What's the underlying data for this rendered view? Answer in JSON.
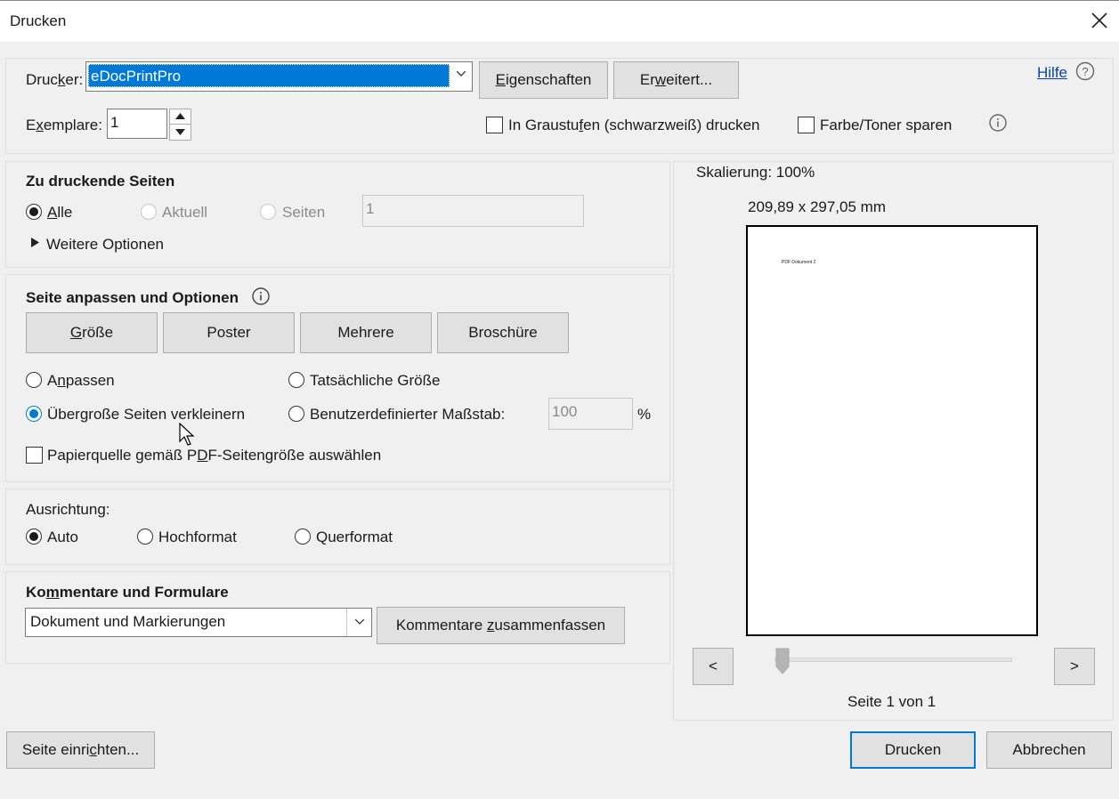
{
  "window": {
    "title": "Drucken"
  },
  "printer": {
    "label": "Drucker:",
    "value": "eDocPrintPro",
    "properties_button": "Eigenschaften",
    "advanced_button": "Erweitert...",
    "help_link": "Hilfe"
  },
  "copies": {
    "label": "Exemplare:",
    "value": "1"
  },
  "options": {
    "grayscale": "In Graustufen (schwarzweiß) drucken",
    "save_ink": "Farbe/Toner sparen"
  },
  "pages_section": {
    "title": "Zu druckende Seiten",
    "all": "Alle",
    "current": "Aktuell",
    "pages": "Seiten",
    "pages_value": "1",
    "more_options": "Weitere Optionen"
  },
  "sizing_section": {
    "title": "Seite anpassen und Optionen",
    "tabs": [
      "Größe",
      "Poster",
      "Mehrere",
      "Broschüre"
    ],
    "fit": "Anpassen",
    "actual_size": "Tatsächliche Größe",
    "shrink": "Übergroße Seiten verkleinern",
    "custom_scale": "Benutzerdefinierter Maßstab:",
    "scale_value": "100",
    "percent": "%",
    "paper_source": "Papierquelle gemäß PDF-Seitengröße auswählen"
  },
  "orientation": {
    "label": "Ausrichtung:",
    "auto": "Auto",
    "portrait": "Hochformat",
    "landscape": "Querformat"
  },
  "comments": {
    "title": "Kommentare und Formulare",
    "value": "Dokument und Markierungen",
    "summarize_button": "Kommentare zusammenfassen"
  },
  "preview": {
    "scaling": "Skalierung: 100%",
    "dimensions": "209,89 x 297,05 mm",
    "page_text": "PDF Dokument 2",
    "prev": "<",
    "next": ">",
    "page_counter": "Seite 1 von 1"
  },
  "footer": {
    "page_setup": "Seite einrichten...",
    "print": "Drucken",
    "cancel": "Abbrechen"
  },
  "colors": {
    "accent": "#0078d7",
    "background": "#f0f0f0"
  }
}
